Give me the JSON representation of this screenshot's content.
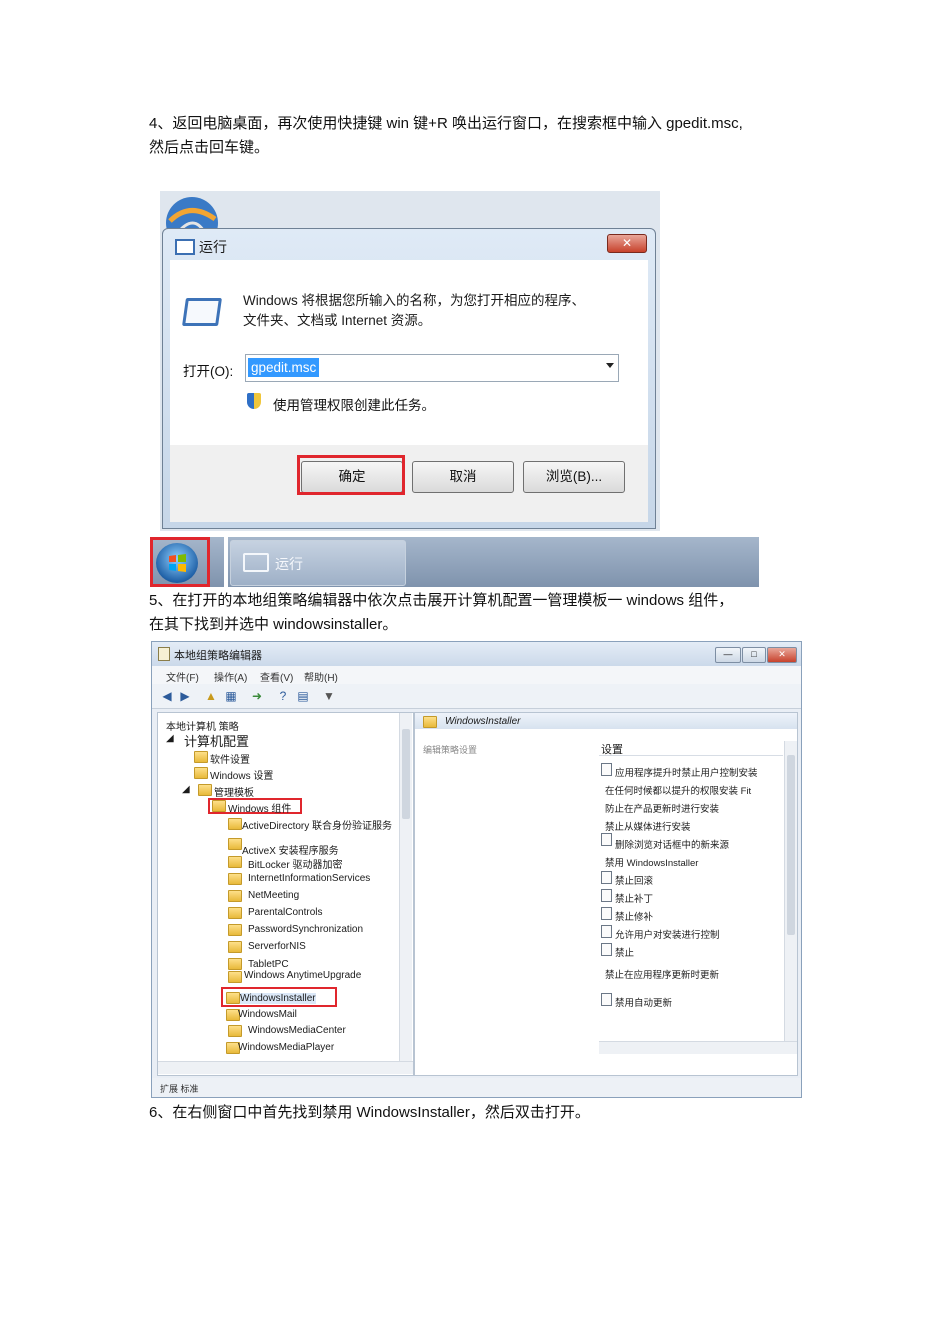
{
  "text": {
    "step4_line1": "4、返回电脑桌面，再次使用快捷键 win 键+R 唤出运行窗口，在搜索框中输入 gpedit.msc,",
    "step4_line2": "然后点击回车键。",
    "step5_line1": "5、在打开的本地组策略编辑器中依次点击展开计算机配置一管理模板一 windows 组件，",
    "step5_line2": "在其下找到并选中 windowsinstaller。",
    "step6_line1": "6、在右侧窗口中首先找到禁用 WindowsInstaller，然后双击打开。"
  },
  "run_dialog": {
    "title": "运行",
    "close": "✕",
    "description_line1": "Windows 将根据您所输入的名称，为您打开相应的程序、",
    "description_line2": "文件夹、文档或 Internet 资源。",
    "open_label": "打开(O):",
    "open_value": "gpedit.msc",
    "admin_note": "使用管理权限创建此任务。",
    "ok": "确定",
    "cancel": "取消",
    "browse": "浏览(B)..."
  },
  "taskbar": {
    "run_label": "运行"
  },
  "gpedit": {
    "title": "本地组策略编辑器",
    "menu": [
      "文件(F)",
      "操作(A)",
      "查看(V)",
      "帮助(H)"
    ],
    "window_buttons": [
      "—",
      "□",
      "✕"
    ],
    "left_tree": [
      "本地计算机 策略",
      "计算机配置",
      "软件设置",
      "Windows 设置",
      "管理模板",
      "Windows 组件",
      "ActiveDirectory 联合身份验证服务",
      "ActiveX 安装程序服务",
      "BitLocker 驱动器加密",
      "InternetInformationServices",
      "NetMeeting",
      "ParentalControls",
      "PasswordSynchronization",
      "ServerforNIS",
      "TabletPC",
      "Windows AnytimeUpgrade",
      "WindowsInstaller",
      "WindowsMail",
      "WindowsMediaCenter",
      "WindowsMediaPlayer"
    ],
    "right_header": "WindowsInstaller",
    "right_desc": "编辑策略设置",
    "settings_header": "设置",
    "settings": [
      "应用程序提升时禁止用户控制安装",
      "在任何时候都以提升的权限安装 Fit",
      "防止在产品更新时进行安装",
      "禁止从媒体进行安装",
      "删除浏览对话框中的新来源",
      "禁用 WindowsInstaller",
      "禁止回滚",
      "禁止补丁",
      "禁止修补",
      "允许用户对安装进行控制",
      "禁止",
      "禁止在应用程序更新时更新",
      "禁用自动更新"
    ],
    "status": "扩展 标准"
  }
}
